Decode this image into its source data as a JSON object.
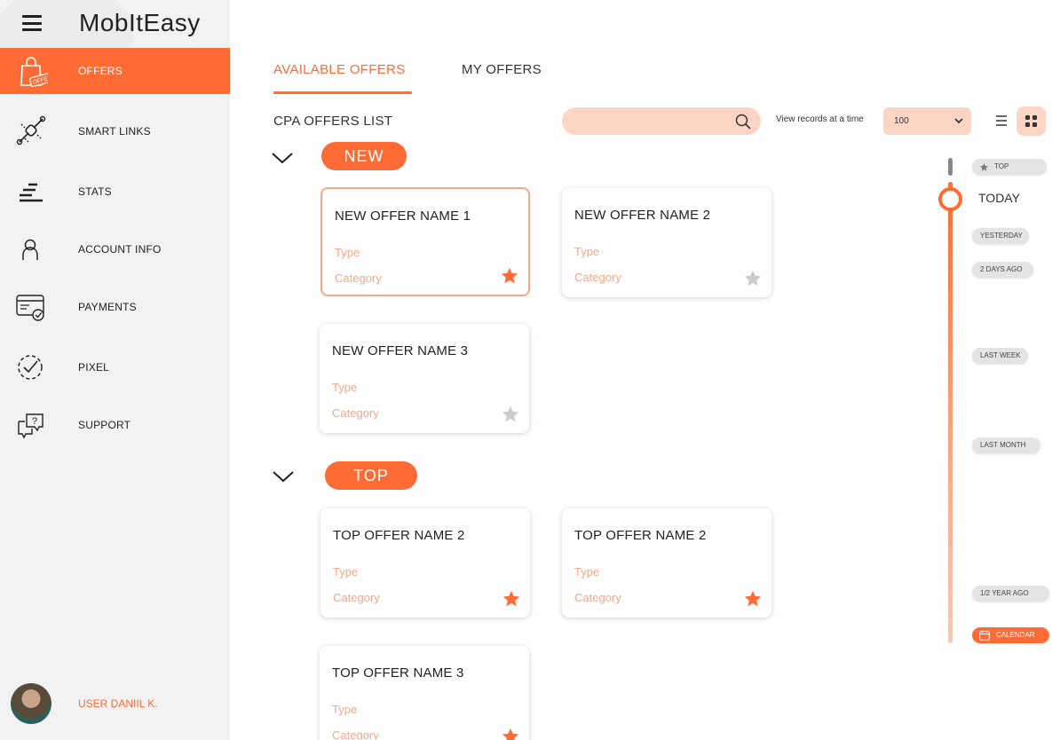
{
  "app": {
    "title": "MobItEasy"
  },
  "sidebar": {
    "items": [
      {
        "label": "OFFERS",
        "icon": "shopping-bag-icon",
        "active": true
      },
      {
        "label": "SMART LINKS",
        "icon": "link-chain-icon"
      },
      {
        "label": "STATS",
        "icon": "stats-bars-icon"
      },
      {
        "label": "ACCOUNT INFO",
        "icon": "user-icon"
      },
      {
        "label": "PAYMENTS",
        "icon": "card-check-icon"
      },
      {
        "label": "PIXEL",
        "icon": "dashed-check-icon"
      },
      {
        "label": "SUPPORT",
        "icon": "chat-question-icon"
      }
    ],
    "offer_tag": "OFFER",
    "user": {
      "label": "USER DANIIL K."
    }
  },
  "tabs": [
    {
      "label": "AVAILABLE OFFERS",
      "active": true
    },
    {
      "label": "MY OFFERS",
      "active": false
    }
  ],
  "toolbar": {
    "list_title": "CPA OFFERS LIST",
    "search_value": "",
    "view_label": "View  records at a time",
    "records_value": "100"
  },
  "sections": [
    {
      "label": "NEW",
      "offers": [
        {
          "title": "NEW OFFER NAME 1",
          "type": "Type",
          "category": "Category",
          "starred": true,
          "selected": true
        },
        {
          "title": "NEW OFFER NAME 2",
          "type": "Type",
          "category": "Category",
          "starred": false
        },
        {
          "title": "NEW OFFER NAME 3",
          "type": "Type",
          "category": "Category",
          "starred": false
        }
      ]
    },
    {
      "label": "TOP",
      "offers": [
        {
          "title": "TOP OFFER NAME 2",
          "type": "Type",
          "category": "Category",
          "starred": true
        },
        {
          "title": "TOP OFFER NAME 2",
          "type": "Type",
          "category": "Category",
          "starred": true
        },
        {
          "title": "TOP OFFER NAME 3",
          "type": "Type",
          "category": "Category",
          "starred": true
        }
      ]
    }
  ],
  "timeline": {
    "top": "TOP",
    "today": "TODAY",
    "yesterday": "YESTERDAY",
    "two_days": "2 DAYS AGO",
    "last_week": "LAST WEEK",
    "last_month": "LAST MONTH",
    "half_year": "1/2 YEAR AGO",
    "calendar": "CALENDAR"
  },
  "colors": {
    "accent": "#ff6b35",
    "accent_light": "#fdd5c4",
    "muted_text": "#f5a88a",
    "sidebar_bg": "#f2f2f2",
    "star_off": "#cccccc"
  }
}
